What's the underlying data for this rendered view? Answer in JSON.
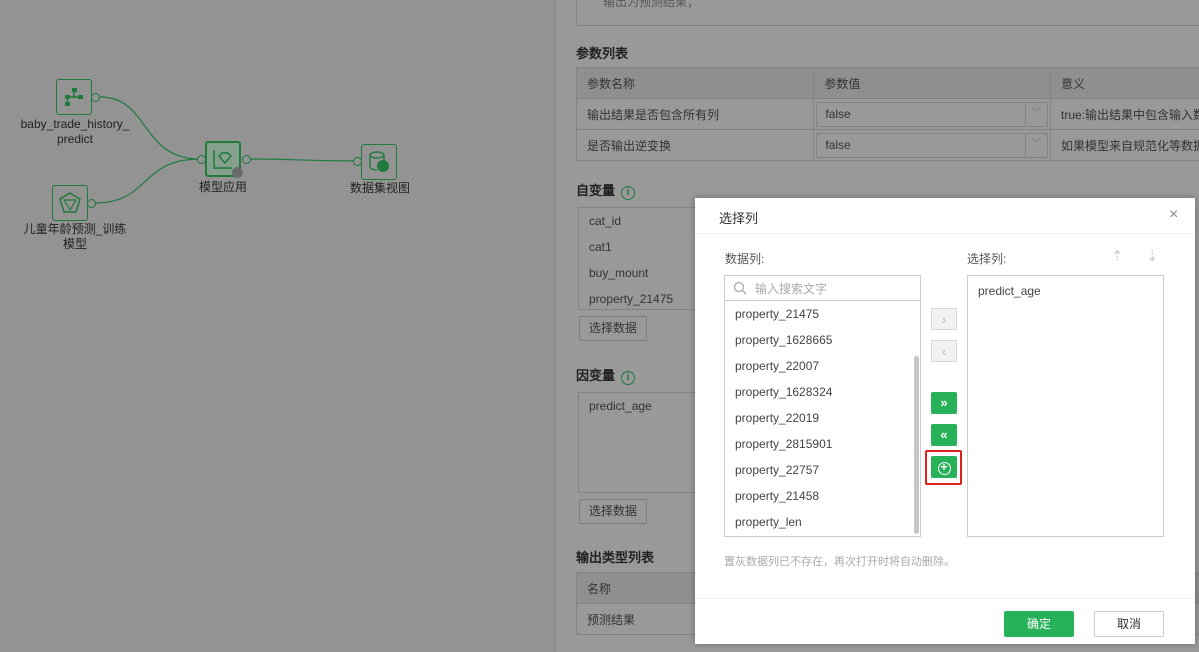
{
  "canvas": {
    "nodes": [
      {
        "label": "baby_trade_history_\npredict",
        "icon": "data-source-icon"
      },
      {
        "label": "儿童年龄预测_训练\n模型",
        "icon": "python-model-icon"
      },
      {
        "label": "模型应用",
        "icon": "model-apply-icon"
      },
      {
        "label": "数据集视图",
        "icon": "dataset-view-icon"
      }
    ]
  },
  "panel": {
    "top_text": "输出为预测结果；",
    "params_title": "参数列表",
    "params_headers": [
      "参数名称",
      "参数值",
      "意义"
    ],
    "params_rows": [
      {
        "name": "输出结果是否包含所有列",
        "value": "false",
        "meaning": "true:输出结果中包含输入数"
      },
      {
        "name": "是否输出逆变换",
        "value": "false",
        "meaning": "如果模型来自规范化等数据"
      }
    ],
    "indep_title": "自变量",
    "indep_items": [
      "cat_id",
      "cat1",
      "buy_mount",
      "property_21475"
    ],
    "select_data": "选择数据",
    "dep_title": "因变量",
    "dep_items": [
      "predict_age"
    ],
    "output_title": "输出类型列表",
    "output_header": "名称",
    "output_row": "预测结果"
  },
  "dialog": {
    "title": "选择列",
    "data_cols_label": "数据列:",
    "selected_label": "选择列:",
    "search_placeholder": "输入搜索文字",
    "data_cols": [
      "property_21475",
      "property_1628665",
      "property_22007",
      "property_1628324",
      "property_22019",
      "property_2815901",
      "property_22757",
      "property_21458",
      "property_len"
    ],
    "selected_cols": [
      "predict_age"
    ],
    "hint": "置灰数据列已不存在，再次打开时将自动删除。",
    "ok": "确定",
    "cancel": "取消",
    "accent": "#27b259"
  }
}
